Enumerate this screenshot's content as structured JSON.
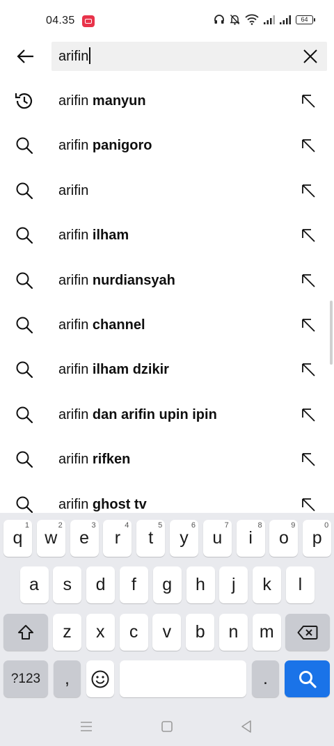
{
  "status_bar": {
    "time": "04.35",
    "battery": "64"
  },
  "search": {
    "query": "arifin"
  },
  "suggestions": [
    {
      "prefix": "arifin",
      "completion": "manyun",
      "icon": "history-icon"
    },
    {
      "prefix": "arifin",
      "completion": "panigoro",
      "icon": "search-icon"
    },
    {
      "prefix": "arifin",
      "completion": "",
      "icon": "search-icon"
    },
    {
      "prefix": "arifin",
      "completion": "ilham",
      "icon": "search-icon"
    },
    {
      "prefix": "arifin",
      "completion": "nurdiansyah",
      "icon": "search-icon"
    },
    {
      "prefix": "arifin",
      "completion": "channel",
      "icon": "search-icon"
    },
    {
      "prefix": "arifin",
      "completion": "ilham dzikir",
      "icon": "search-icon"
    },
    {
      "prefix": "arifin",
      "completion": "dan arifin upin ipin",
      "icon": "search-icon"
    },
    {
      "prefix": "arifin",
      "completion": "rifken",
      "icon": "search-icon"
    },
    {
      "prefix": "arifin",
      "completion": "ghost tv",
      "icon": "search-icon"
    }
  ],
  "keyboard": {
    "row1": [
      {
        "k": "q",
        "h": "1"
      },
      {
        "k": "w",
        "h": "2"
      },
      {
        "k": "e",
        "h": "3"
      },
      {
        "k": "r",
        "h": "4"
      },
      {
        "k": "t",
        "h": "5"
      },
      {
        "k": "y",
        "h": "6"
      },
      {
        "k": "u",
        "h": "7"
      },
      {
        "k": "i",
        "h": "8"
      },
      {
        "k": "o",
        "h": "9"
      },
      {
        "k": "p",
        "h": "0"
      }
    ],
    "row2": [
      "a",
      "s",
      "d",
      "f",
      "g",
      "h",
      "j",
      "k",
      "l"
    ],
    "row3": [
      "z",
      "x",
      "c",
      "v",
      "b",
      "n",
      "m"
    ],
    "symbols_label": "?123",
    "comma_label": ",",
    "period_label": "."
  },
  "colors": {
    "accent": "#1a73e8",
    "keyboard_bg": "#e9eaee",
    "function_key": "#c9cbd1"
  }
}
